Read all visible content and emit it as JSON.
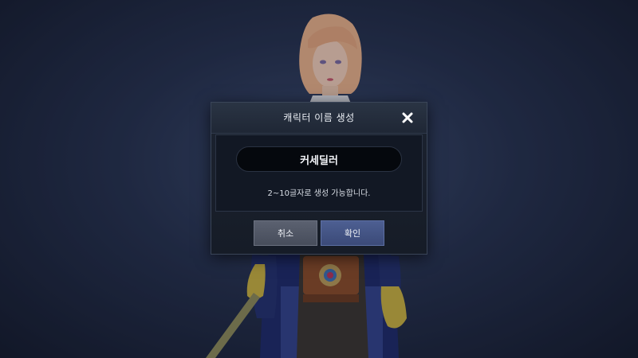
{
  "dialog": {
    "title": "캐릭터 이름 생성",
    "name_value": "커세딜러",
    "hint": "2~10글자로 생성 가능합니다.",
    "cancel_label": "취소",
    "confirm_label": "확인"
  },
  "colors": {
    "background": "#25304d",
    "dialog_bg": "#1a212d",
    "confirm_button": "#45568a",
    "cancel_button": "#525867"
  },
  "icons": {
    "close": "close-icon"
  }
}
